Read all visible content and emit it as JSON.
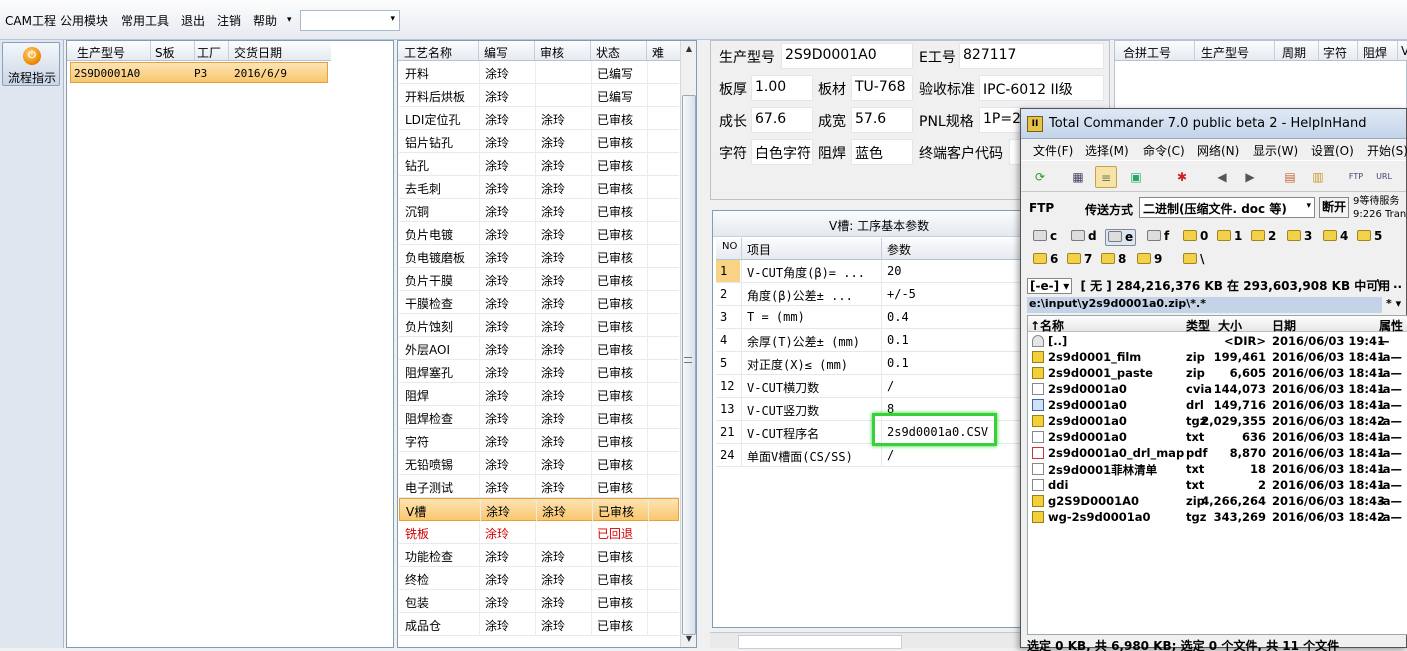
{
  "menubar": {
    "items": [
      "CAM工程",
      "公用模块",
      "常用工具",
      "退出",
      "注销",
      "帮助"
    ],
    "dropdown_arrow": "▾",
    "combo_value": ""
  },
  "leftbar": {
    "flow_button": "流程指示",
    "flow_icon": "power-icon"
  },
  "orders": {
    "headers": [
      "生产型号",
      "S板",
      "工厂",
      "交货日期"
    ],
    "rows": [
      [
        "2S9D0001A0",
        "",
        "P3",
        "2016/6/9"
      ]
    ]
  },
  "processes": {
    "headers": [
      "工艺名称",
      "编写",
      "审核",
      "状态",
      "难"
    ],
    "rows": [
      [
        "开料",
        "涂玲",
        "",
        "已编写"
      ],
      [
        "开料后烘板",
        "涂玲",
        "",
        "已编写"
      ],
      [
        "LDI定位孔",
        "涂玲",
        "涂玲",
        "已审核"
      ],
      [
        "铝片钻孔",
        "涂玲",
        "涂玲",
        "已审核"
      ],
      [
        "钻孔",
        "涂玲",
        "涂玲",
        "已审核"
      ],
      [
        "去毛刺",
        "涂玲",
        "涂玲",
        "已审核"
      ],
      [
        "沉铜",
        "涂玲",
        "涂玲",
        "已审核"
      ],
      [
        "负片电镀",
        "涂玲",
        "涂玲",
        "已审核"
      ],
      [
        "负电镀磨板",
        "涂玲",
        "涂玲",
        "已审核"
      ],
      [
        "负片干膜",
        "涂玲",
        "涂玲",
        "已审核"
      ],
      [
        "干膜检查",
        "涂玲",
        "涂玲",
        "已审核"
      ],
      [
        "负片蚀刻",
        "涂玲",
        "涂玲",
        "已审核"
      ],
      [
        "外层AOI",
        "涂玲",
        "涂玲",
        "已审核"
      ],
      [
        "阻焊塞孔",
        "涂玲",
        "涂玲",
        "已审核"
      ],
      [
        "阻焊",
        "涂玲",
        "涂玲",
        "已审核"
      ],
      [
        "阻焊检查",
        "涂玲",
        "涂玲",
        "已审核"
      ],
      [
        "字符",
        "涂玲",
        "涂玲",
        "已审核"
      ],
      [
        "无铅喷锡",
        "涂玲",
        "涂玲",
        "已审核"
      ],
      [
        "电子测试",
        "涂玲",
        "涂玲",
        "已审核"
      ],
      [
        "V槽",
        "涂玲",
        "涂玲",
        "已审核"
      ],
      [
        "铣板",
        "涂玲",
        "",
        "已回退"
      ],
      [
        "功能检查",
        "涂玲",
        "涂玲",
        "已审核"
      ],
      [
        "终检",
        "涂玲",
        "涂玲",
        "已审核"
      ],
      [
        "包装",
        "涂玲",
        "涂玲",
        "已审核"
      ],
      [
        "成品仓",
        "涂玲",
        "涂玲",
        "已审核"
      ]
    ],
    "selected_index": 19,
    "rejected_index": 20
  },
  "info": {
    "fields": [
      {
        "label": "生产型号",
        "value": "2S9D0001A0"
      },
      {
        "label": "E工号",
        "value": "827117"
      },
      {
        "label": "板厚",
        "value": "1.00"
      },
      {
        "label": "板材",
        "value": "TU-768"
      },
      {
        "label": "验收标准",
        "value": "IPC-6012 II级"
      },
      {
        "label": "成长",
        "value": "67.6"
      },
      {
        "label": "成宽",
        "value": "57.6"
      },
      {
        "label": "PNL规格",
        "value": "1P=2"
      },
      {
        "label": "字符",
        "value": "白色字符"
      },
      {
        "label": "阻焊",
        "value": "蓝色"
      },
      {
        "label": "终端客户代码",
        "value": ""
      }
    ]
  },
  "vcut": {
    "title": "V槽: 工序基本参数",
    "headers": [
      "NO",
      "项目",
      "参数"
    ],
    "rows": [
      [
        "1",
        "V-CUT角度(β)=  ...",
        "20"
      ],
      [
        "2",
        "角度(β)公差±  ...",
        "+/-5"
      ],
      [
        "3",
        "T =  (mm)",
        "0.4"
      ],
      [
        "4",
        "余厚(T)公差±  (mm)",
        "0.1"
      ],
      [
        "5",
        "对正度(X)≤ (mm)",
        "0.1"
      ],
      [
        "12",
        "V-CUT横刀数",
        "/"
      ],
      [
        "13",
        "V-CUT竖刀数",
        "8"
      ],
      [
        "21",
        "V-CUT程序名",
        "2s9d0001a0.CSV"
      ],
      [
        "24",
        "单面V槽面(CS/SS)",
        "/"
      ]
    ]
  },
  "combine": {
    "headers": [
      "合拼工号",
      "生产型号",
      "周期",
      "字符",
      "阻焊",
      "V"
    ]
  },
  "tc": {
    "title": "Total Commander 7.0 public beta 2 - HelpInHand",
    "title_icon": "II",
    "menu": [
      "文件(F)",
      "选择(M)",
      "命令(C)",
      "网络(N)",
      "显示(W)",
      "设置(O)",
      "开始(S)"
    ],
    "ftp_label": "FTP",
    "transfer_label": "传送方式",
    "transfer_value": "二进制(压缩文件. doc 等)",
    "transfer_arrow": "▾",
    "disconnect": "断开",
    "status_line1": "9等待服务",
    "status_line2": "9:226 Tran",
    "drives": [
      "c",
      "d",
      "e",
      "f",
      "0",
      "1",
      "2",
      "3",
      "4",
      "5",
      "6",
      "7",
      "8",
      "9",
      "\\"
    ],
    "drive_select": "[-e-] ▾",
    "free_space": "[ 无 ]  284,216,376 KB 在 293,603,908 KB 中可用",
    "root_link": "\\",
    "updir_link": "..",
    "path": "e:\\input\\y2s9d0001a0.zip\\*.*",
    "path_filter": "* ▾",
    "list_headers": [
      "↑名称",
      "类型",
      "大小",
      "日期",
      "属性"
    ],
    "files": [
      {
        "name": "[..]",
        "type": "",
        "size": "<DIR>",
        "date": "2016/06/03 19:41",
        "attr": "—",
        "icon": "up"
      },
      {
        "name": "2s9d0001_film",
        "type": "zip",
        "size": "199,461",
        "date": "2016/06/03 18:41",
        "attr": "-a—",
        "icon": "zip"
      },
      {
        "name": "2s9d0001_paste",
        "type": "zip",
        "size": "6,605",
        "date": "2016/06/03 18:41",
        "attr": "-a—",
        "icon": "zip"
      },
      {
        "name": "2s9d0001a0",
        "type": "cvia",
        "size": "144,073",
        "date": "2016/06/03 18:41",
        "attr": "-a—",
        "icon": "doc"
      },
      {
        "name": "2s9d0001a0",
        "type": "drl",
        "size": "149,716",
        "date": "2016/06/03 18:41",
        "attr": "-a—",
        "icon": "drl"
      },
      {
        "name": "2s9d0001a0",
        "type": "tgz",
        "size": "2,029,355",
        "date": "2016/06/03 18:42",
        "attr": "-a—",
        "icon": "zip"
      },
      {
        "name": "2s9d0001a0",
        "type": "txt",
        "size": "636",
        "date": "2016/06/03 18:41",
        "attr": "-a—",
        "icon": "doc"
      },
      {
        "name": "2s9d0001a0_drl_map",
        "type": "pdf",
        "size": "8,870",
        "date": "2016/06/03 18:41",
        "attr": "-a—",
        "icon": "pdf"
      },
      {
        "name": "2s9d0001菲林清单",
        "type": "txt",
        "size": "18",
        "date": "2016/06/03 18:41",
        "attr": "-a—",
        "icon": "doc"
      },
      {
        "name": "ddi",
        "type": "txt",
        "size": "2",
        "date": "2016/06/03 18:41",
        "attr": "-a—",
        "icon": "doc"
      },
      {
        "name": "g2S9D0001A0",
        "type": "zip",
        "size": "4,266,264",
        "date": "2016/06/03 18:43",
        "attr": "-a—",
        "icon": "zip"
      },
      {
        "name": "wg-2s9d0001a0",
        "type": "tgz",
        "size": "343,269",
        "date": "2016/06/03 18:42",
        "attr": "-a—",
        "icon": "zip"
      }
    ],
    "status": "选定 0 KB, 共 6,980 KB; 选定 0 个文件, 共 11 个文件"
  }
}
